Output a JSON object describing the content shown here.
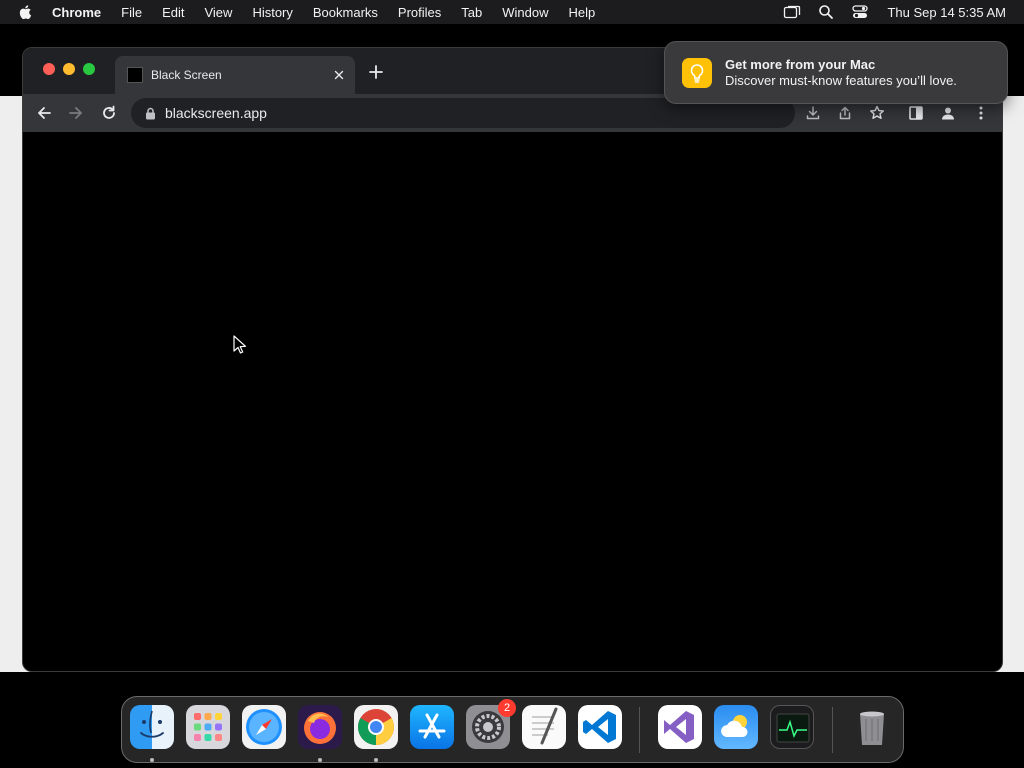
{
  "menubar": {
    "apple_icon": "apple-logo-icon",
    "app_name": "Chrome",
    "items": [
      "File",
      "Edit",
      "View",
      "History",
      "Bookmarks",
      "Profiles",
      "Tab",
      "Window",
      "Help"
    ],
    "clock": "Thu Sep 14  5:35 AM",
    "status_icons": [
      "screen-mirroring-icon",
      "spotlight-search-icon",
      "control-center-icon"
    ]
  },
  "browser": {
    "tab": {
      "title": "Black Screen",
      "favicon": "black-square-icon"
    },
    "omnibox": {
      "url": "blackscreen.app"
    },
    "toolbar_icons": [
      "download-icon",
      "share-icon",
      "bookmark-star-icon",
      "side-panel-icon",
      "profile-icon",
      "more-menu-icon"
    ],
    "page_background": "#000000"
  },
  "notification": {
    "title": "Get more from your Mac",
    "body": "Discover must-know features you’ll love.",
    "icon": "tips-lightbulb-icon",
    "icon_color": "#ffc107"
  },
  "dock": {
    "apps": [
      {
        "name": "Finder",
        "icon": "finder-icon",
        "running": true
      },
      {
        "name": "Launchpad",
        "icon": "launchpad-icon",
        "running": false
      },
      {
        "name": "Safari",
        "icon": "safari-icon",
        "running": false
      },
      {
        "name": "Firefox",
        "icon": "firefox-icon",
        "running": true
      },
      {
        "name": "Chrome",
        "icon": "chrome-icon",
        "running": true
      },
      {
        "name": "App Store",
        "icon": "app-store-icon",
        "running": false
      },
      {
        "name": "System Settings",
        "icon": "system-settings-icon",
        "running": false,
        "badge": "2"
      },
      {
        "name": "TextEdit",
        "icon": "textedit-icon",
        "running": false
      },
      {
        "name": "Visual Studio Code",
        "icon": "vscode-icon",
        "running": false
      },
      {
        "name": "Visual Studio",
        "icon": "visual-studio-icon",
        "running": false
      },
      {
        "name": "Weather",
        "icon": "weather-icon",
        "running": false
      },
      {
        "name": "Activity Monitor",
        "icon": "activity-monitor-icon",
        "running": false
      },
      {
        "name": "Trash",
        "icon": "trash-icon",
        "running": false
      }
    ]
  }
}
